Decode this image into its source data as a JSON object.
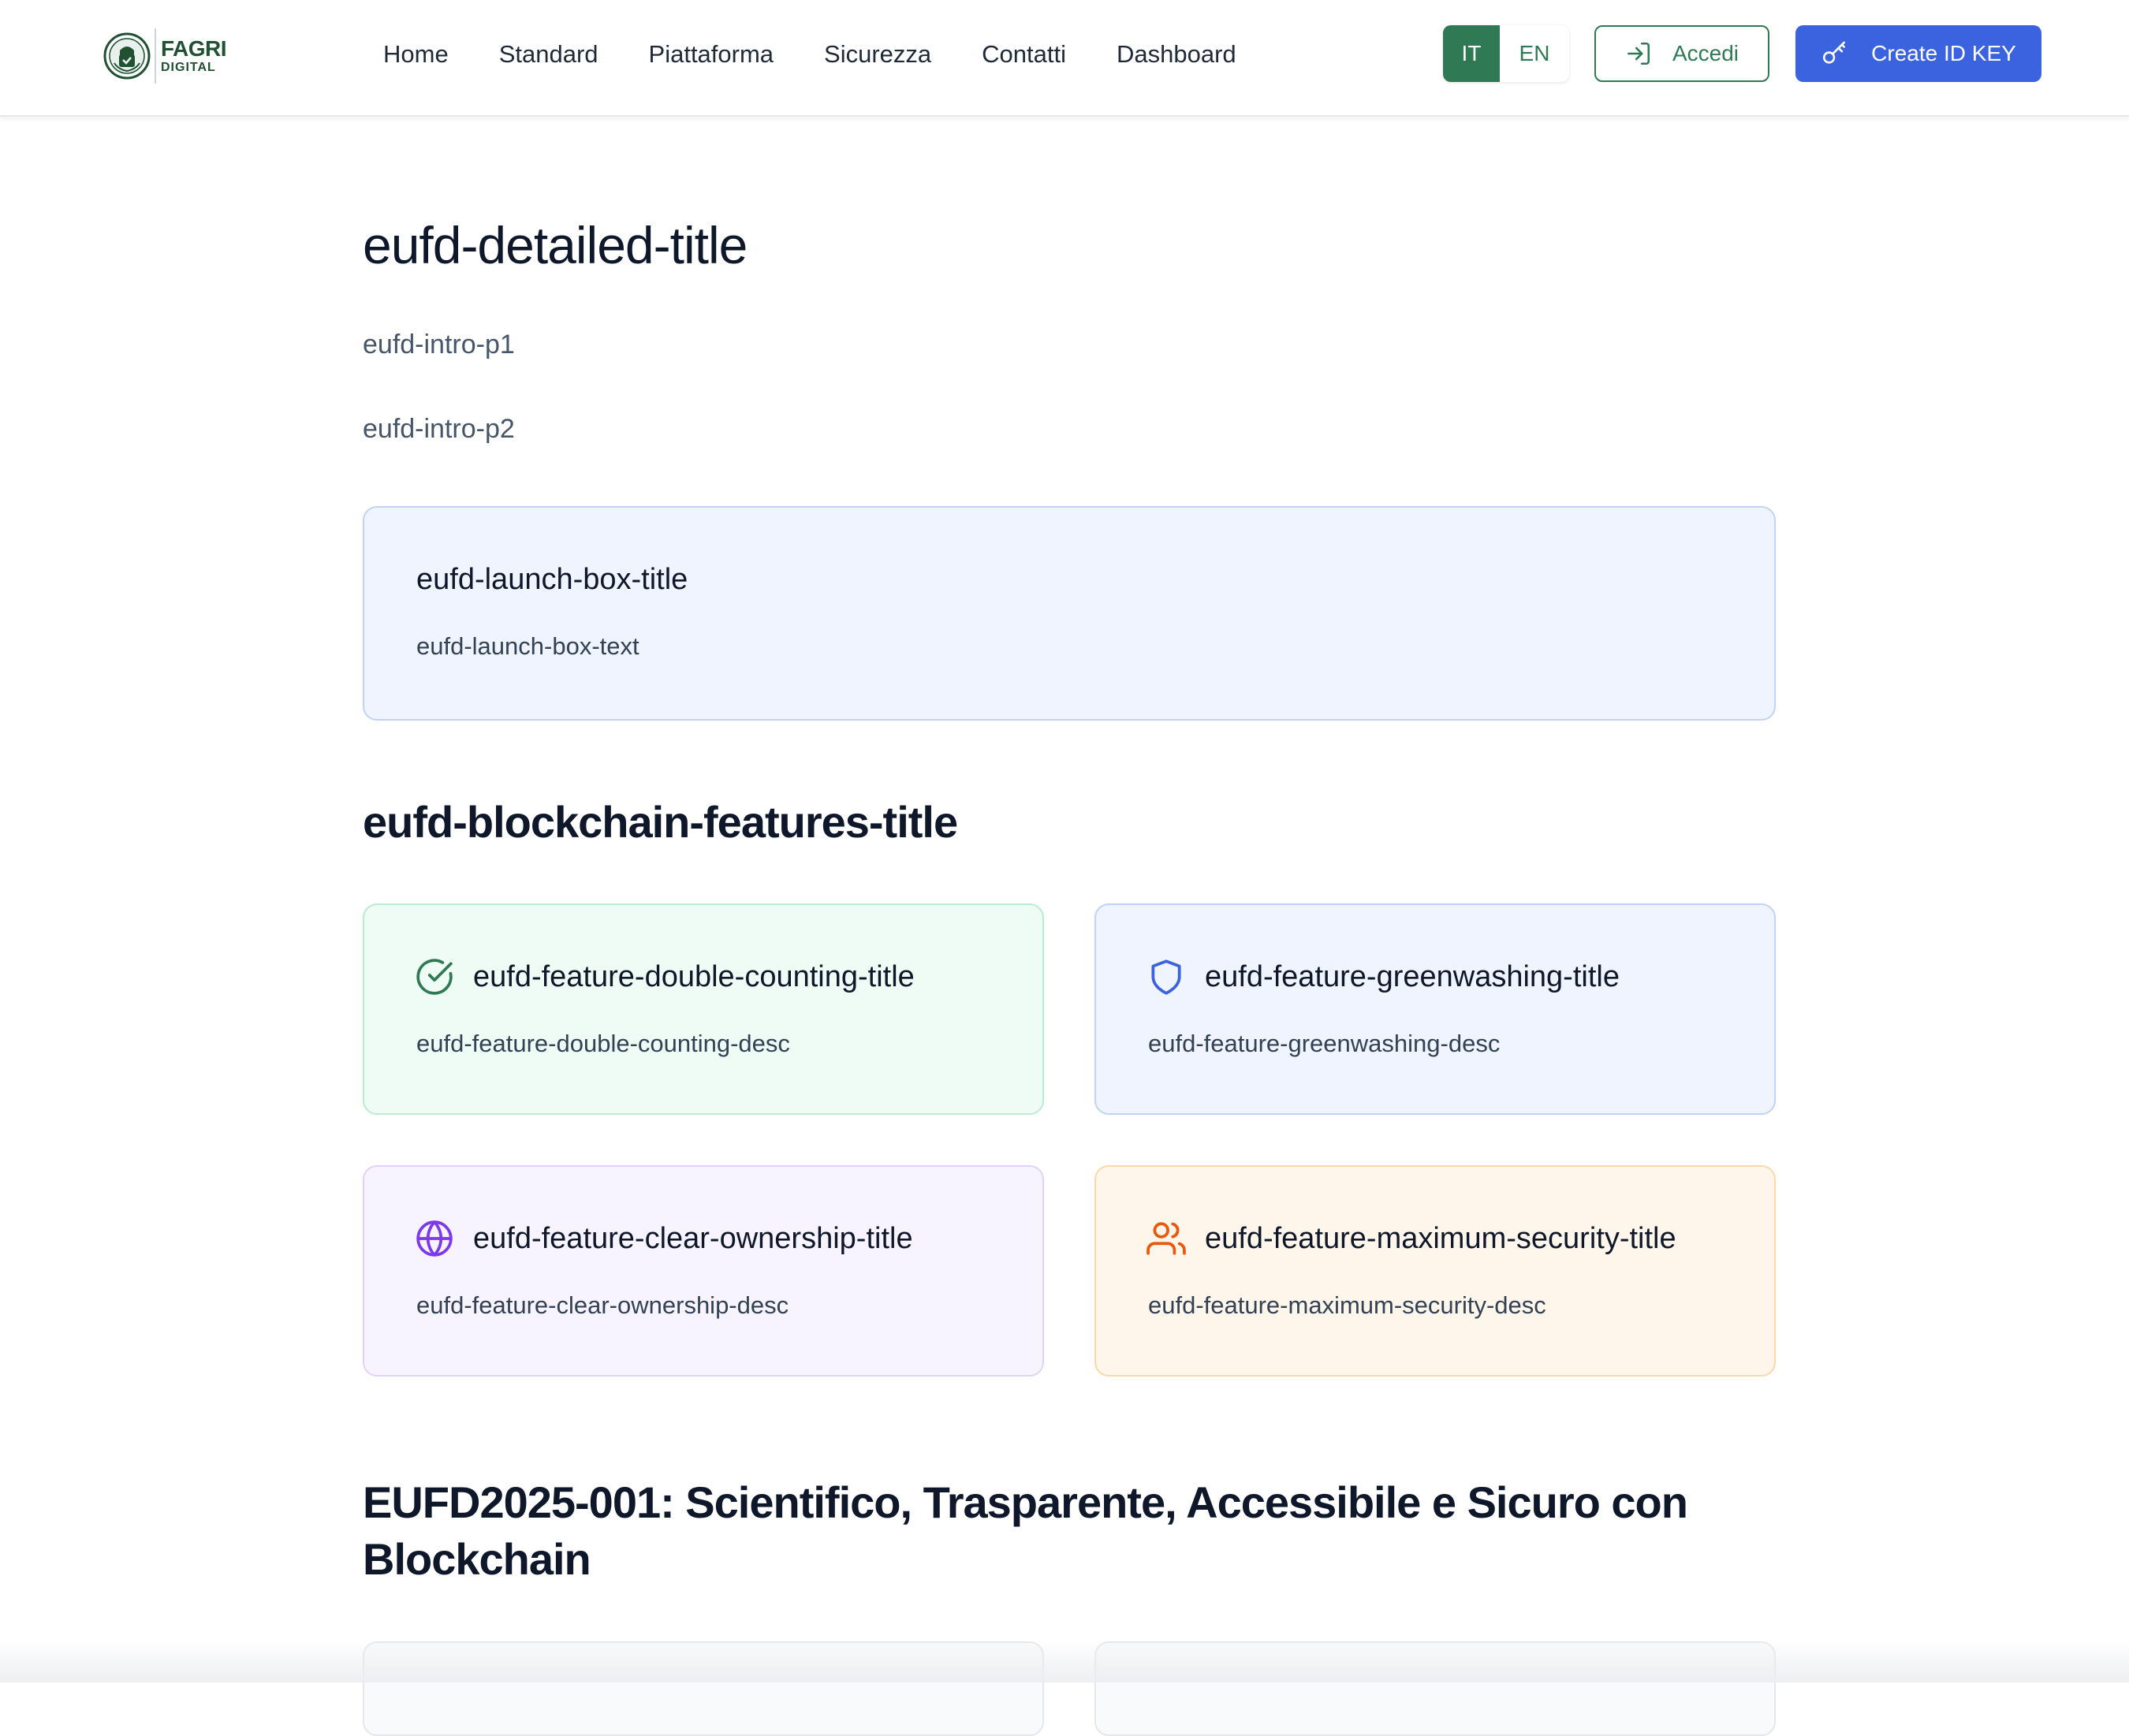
{
  "brand": {
    "line1": "FAGRI",
    "line2": "DIGITAL"
  },
  "nav": {
    "items": [
      {
        "label": "Home"
      },
      {
        "label": "Standard"
      },
      {
        "label": "Piattaforma"
      },
      {
        "label": "Sicurezza"
      },
      {
        "label": "Contatti"
      },
      {
        "label": "Dashboard"
      }
    ]
  },
  "language": {
    "active": "IT",
    "other": "EN"
  },
  "actions": {
    "login_label": "Accedi",
    "login_icon": "login-icon",
    "create_label": "Create ID KEY",
    "create_icon": "key-icon"
  },
  "colors": {
    "brand_green": "#2f7a55",
    "primary_blue": "#3b63e0"
  },
  "page": {
    "title": "eufd-detailed-title",
    "intro_p1": "eufd-intro-p1",
    "intro_p2": "eufd-intro-p2",
    "launch_box": {
      "title": "eufd-launch-box-title",
      "text": "eufd-launch-box-text"
    },
    "features_title": "eufd-blockchain-features-title",
    "features": [
      {
        "title": "eufd-feature-double-counting-title",
        "desc": "eufd-feature-double-counting-desc",
        "icon": "check-circle-icon",
        "color": "#2f7a55"
      },
      {
        "title": "eufd-feature-greenwashing-title",
        "desc": "eufd-feature-greenwashing-desc",
        "icon": "shield-icon",
        "color": "#3b63e0"
      },
      {
        "title": "eufd-feature-clear-ownership-title",
        "desc": "eufd-feature-clear-ownership-desc",
        "icon": "globe-icon",
        "color": "#7c3aed"
      },
      {
        "title": "eufd-feature-maximum-security-title",
        "desc": "eufd-feature-maximum-security-desc",
        "icon": "users-icon",
        "color": "#ea580c"
      }
    ],
    "section_title": "EUFD2025-001: Scientifico, Trasparente, Accessibile e Sicuro con Blockchain"
  }
}
